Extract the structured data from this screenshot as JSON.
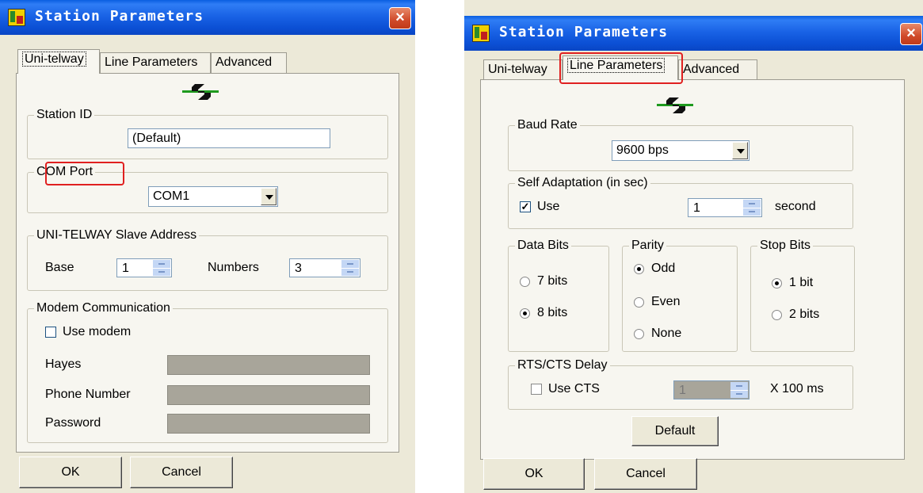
{
  "left": {
    "title": "Station Parameters",
    "close_glyph": "×",
    "tabs": [
      "Uni-telway",
      "Line Parameters",
      "Advanced"
    ],
    "active_tab": "Uni-telway",
    "station_id": {
      "label": "Station ID",
      "value": "(Default)"
    },
    "com_port": {
      "label": "COM Port",
      "value": "COM1"
    },
    "slave_address": {
      "label": "UNI-TELWAY Slave Address",
      "base_label": "Base",
      "base_value": "1",
      "numbers_label": "Numbers",
      "numbers_value": "3"
    },
    "modem": {
      "label": "Modem Communication",
      "use_label": "Use modem",
      "use_checked": false,
      "hayes_label": "Hayes",
      "phone_label": "Phone Number",
      "password_label": "Password"
    },
    "ok_label": "OK",
    "cancel_label": "Cancel"
  },
  "right": {
    "title": "Station Parameters",
    "close_glyph": "×",
    "tabs": [
      "Uni-telway",
      "Line Parameters",
      "Advanced"
    ],
    "active_tab": "Line Parameters",
    "baud_rate": {
      "label": "Baud Rate",
      "value": "9600  bps"
    },
    "self_adaptation": {
      "label": "Self Adaptation (in sec)",
      "use_label": "Use",
      "use_checked": true,
      "value": "1",
      "unit": "second"
    },
    "data_bits": {
      "label": "Data Bits",
      "options": [
        "7 bits",
        "8 bits"
      ],
      "selected": "8 bits"
    },
    "parity": {
      "label": "Parity",
      "options": [
        "Odd",
        "Even",
        "None"
      ],
      "selected": "Odd"
    },
    "stop_bits": {
      "label": "Stop Bits",
      "options": [
        "1 bit",
        "2 bits"
      ],
      "selected": "1 bit"
    },
    "rts_cts": {
      "label": "RTS/CTS Delay",
      "use_label": "Use CTS",
      "use_checked": false,
      "value": "1",
      "unit": "X 100 ms"
    },
    "default_label": "Default",
    "ok_label": "OK",
    "cancel_label": "Cancel"
  },
  "colors": {
    "titlebar": "#0a5ee0",
    "dialog_bg": "#ece9d8",
    "panel_bg": "#f7f6f0",
    "highlight": "#e02020",
    "logo_green": "#1e9a1e"
  }
}
